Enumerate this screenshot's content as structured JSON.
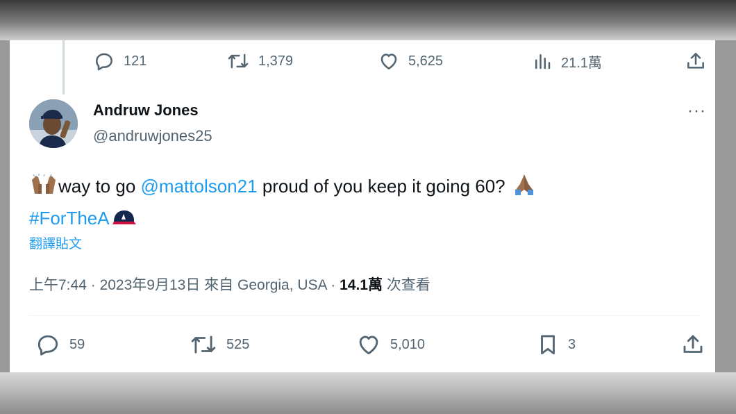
{
  "previous_tweet_actions": {
    "replies": "121",
    "retweets": "1,379",
    "likes": "5,625",
    "views": "21.1萬"
  },
  "author": {
    "name": "Andruw Jones",
    "handle": "@andruwjones25"
  },
  "tweet": {
    "text_before_mention": "way to go",
    "mention": "@mattolson21",
    "text_after_mention": "proud of you keep it going 60?",
    "hashtag": "#ForTheA",
    "translate_label": "翻譯貼文"
  },
  "meta": {
    "time": "上午7:44",
    "date": "2023年9月13日",
    "source": "來自 Georgia, USA",
    "views_count": "14.1萬",
    "views_label": "次查看",
    "separator": "·"
  },
  "actions": {
    "replies": "59",
    "retweets": "525",
    "likes": "5,010",
    "bookmarks": "3"
  },
  "colors": {
    "link": "#1d9bf0",
    "secondary_text": "#536471",
    "primary_text": "#0f1419"
  },
  "icons": [
    "reply-icon",
    "retweet-icon",
    "like-icon",
    "views-icon",
    "share-icon",
    "bookmark-icon",
    "more-icon",
    "raising-hands-emoji",
    "folded-hands-emoji",
    "braves-cap-emoji"
  ]
}
